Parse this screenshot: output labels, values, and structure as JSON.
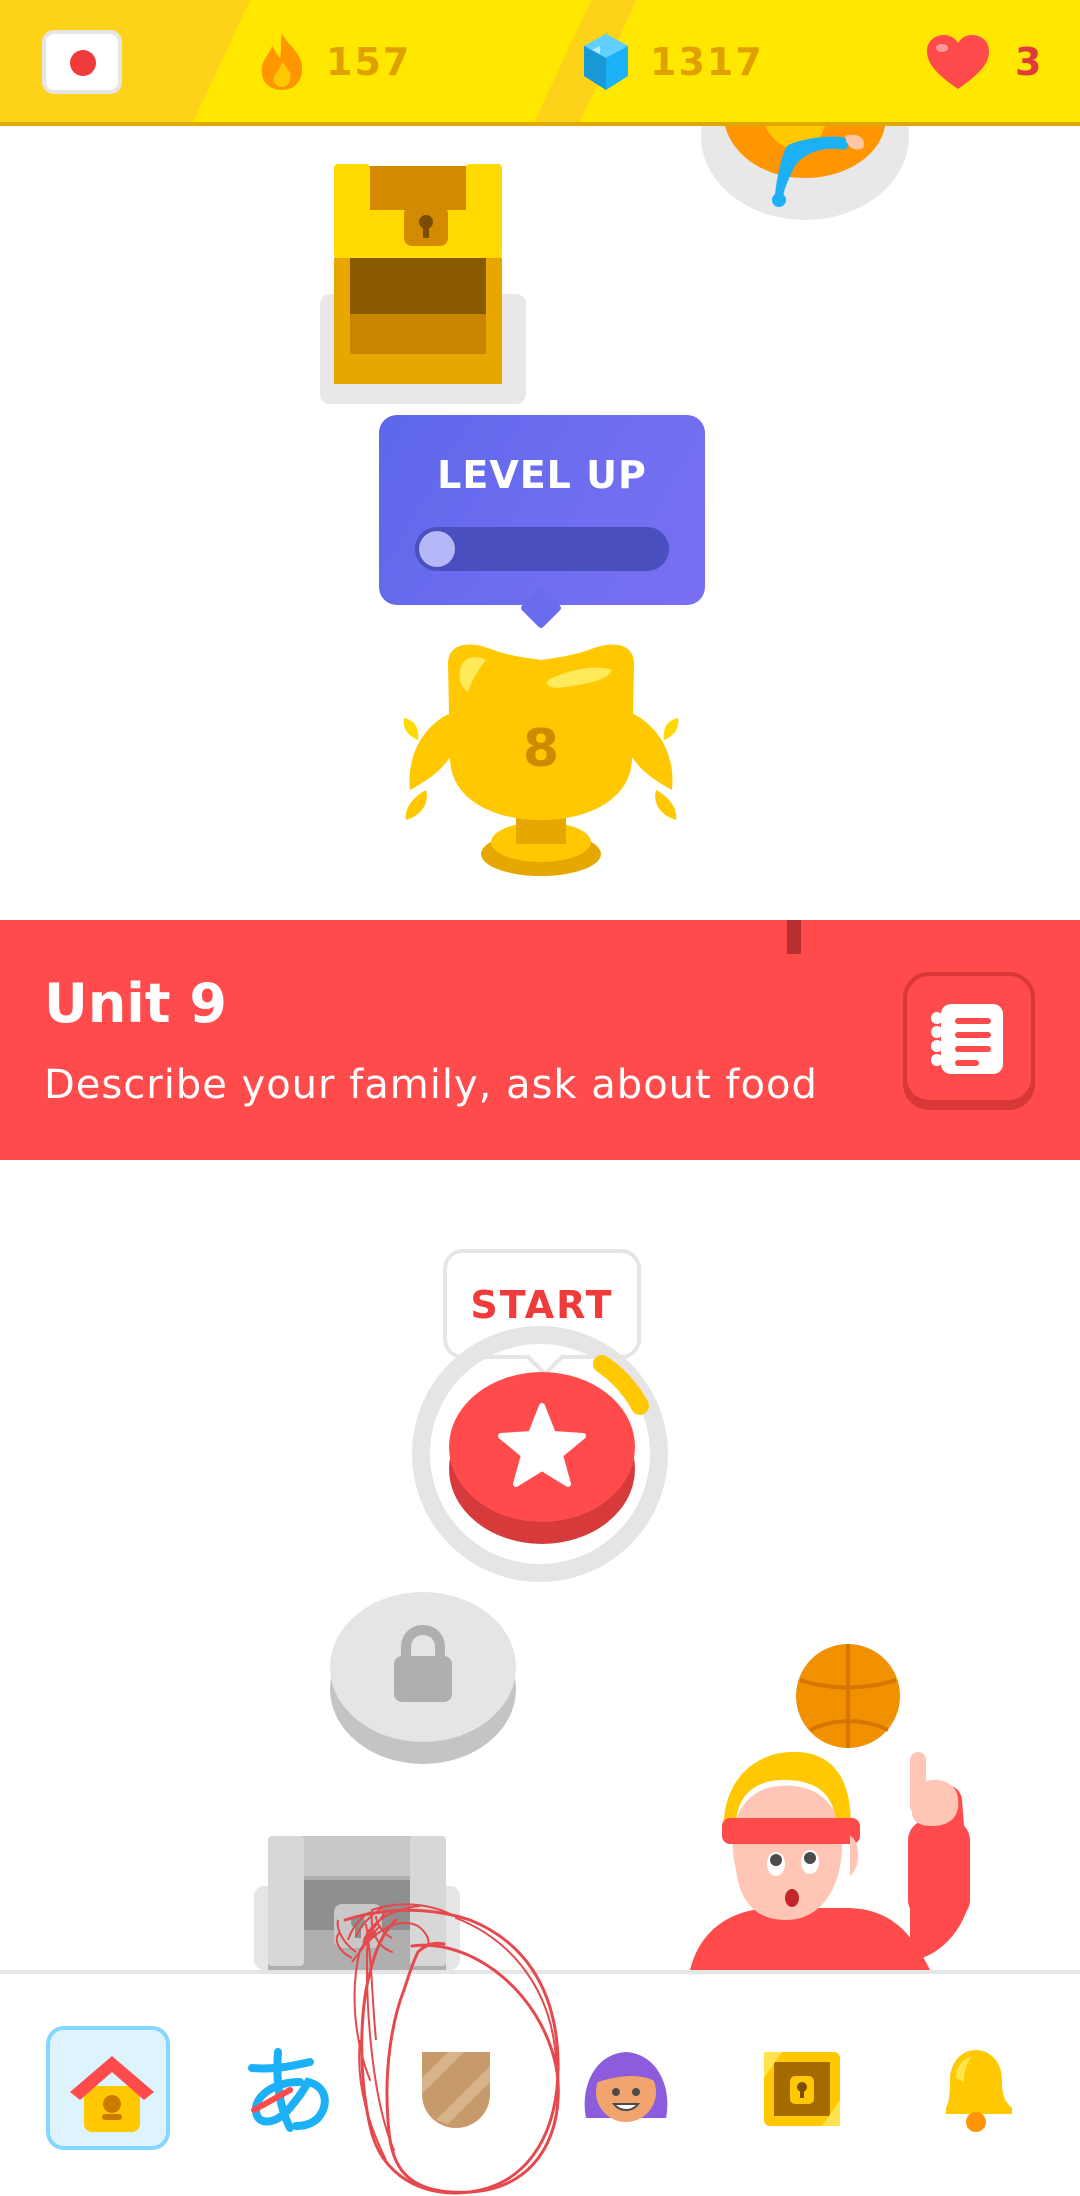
{
  "status_bar": {
    "course_flag": "japan-flag-icon",
    "streak": "157",
    "gems": "1317",
    "hearts": "3"
  },
  "path": {
    "level_up": {
      "title": "LEVEL UP",
      "progress": 0.07
    },
    "trophy_level": "8",
    "unit": {
      "title": "Unit 9",
      "subtitle": "Describe your family, ask about food"
    },
    "start_label": "START"
  },
  "bottom_nav": [
    {
      "name": "home",
      "icon": "home-icon",
      "active": true
    },
    {
      "name": "characters",
      "icon": "hiragana-a-icon"
    },
    {
      "name": "shield",
      "icon": "shield-icon"
    },
    {
      "name": "profile",
      "icon": "profile-avatar-icon"
    },
    {
      "name": "chest",
      "icon": "treasure-chest-icon"
    },
    {
      "name": "notifications",
      "icon": "bell-icon"
    }
  ],
  "colors": {
    "accent_red": "#ff4b4b",
    "gold": "#ffc800",
    "levelup_purple": "#6a6cef",
    "nav_active": "#ddf4ff"
  }
}
